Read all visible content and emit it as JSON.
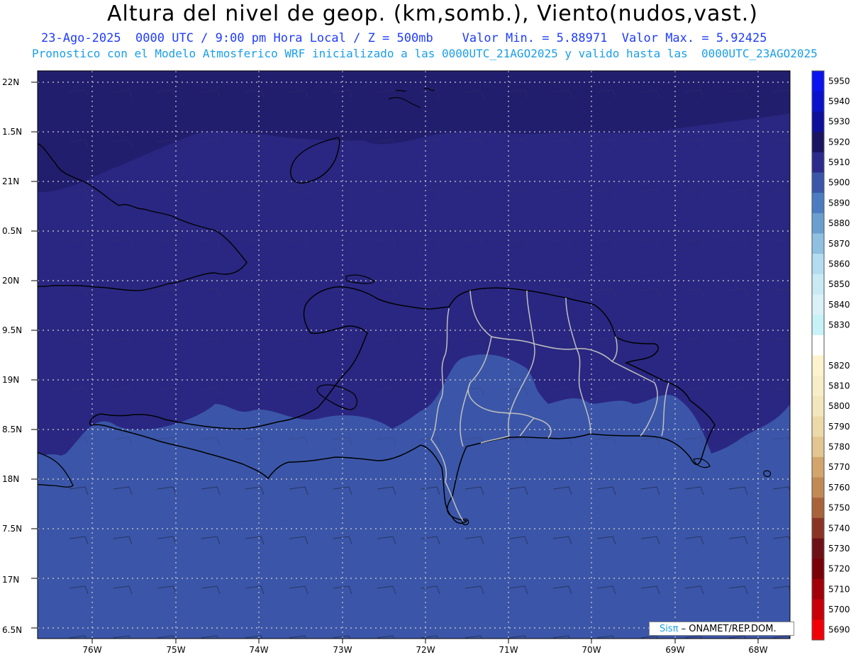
{
  "header": {
    "title": "Altura del nivel de geop. (km,somb.), Viento(nudos,vast.)",
    "line2": "23-Ago-2025  0000 UTC / 9:00 pm Hora Local / Z = 500mb    Valor Min. = 5.88971  Valor Max. = 5.92425",
    "line3": "Pronostico con el Modelo Atmosferico WRF inicializado a las 0000UTC_21AGO2025 y valido hasta las  0000UTC_23AGO2025"
  },
  "axes": {
    "lat_labels": [
      "22N",
      "1.5N",
      "21N",
      "0.5N",
      "20N",
      "9.5N",
      "19N",
      "8.5N",
      "18N",
      "7.5N",
      "17N",
      "6.5N"
    ],
    "lon_labels": [
      "76W",
      "75W",
      "74W",
      "73W",
      "72W",
      "71W",
      "70W",
      "69W",
      "68W"
    ]
  },
  "colorbar": {
    "levels": [
      {
        "label": "5950",
        "color": "#0a13f0"
      },
      {
        "label": "5940",
        "color": "#0b12cc"
      },
      {
        "label": "5930",
        "color": "#0d109a"
      },
      {
        "label": "5920",
        "color": "#1a1462"
      },
      {
        "label": "5910",
        "color": "#2c2a8a"
      },
      {
        "label": "5900",
        "color": "#3b56a8"
      },
      {
        "label": "5890",
        "color": "#4b7cc1"
      },
      {
        "label": "5880",
        "color": "#6a9fd0"
      },
      {
        "label": "5870",
        "color": "#8fc0e0"
      },
      {
        "label": "5860",
        "color": "#b3dcee"
      },
      {
        "label": "5850",
        "color": "#c9eaf5"
      },
      {
        "label": "5840",
        "color": "#daf1f8"
      },
      {
        "label": "5830",
        "color": "#c7f2f7"
      },
      {
        "label": "",
        "color": "#ffffff"
      },
      {
        "label": "5820",
        "color": "#fdf3cf"
      },
      {
        "label": "5810",
        "color": "#f7eec8"
      },
      {
        "label": "5800",
        "color": "#f3e6bc"
      },
      {
        "label": "5790",
        "color": "#ecd9a8"
      },
      {
        "label": "5780",
        "color": "#e2c590"
      },
      {
        "label": "5770",
        "color": "#d1a56d"
      },
      {
        "label": "5760",
        "color": "#c18954"
      },
      {
        "label": "5750",
        "color": "#a9633b"
      },
      {
        "label": "5740",
        "color": "#8a3524"
      },
      {
        "label": "5730",
        "color": "#6e1117"
      },
      {
        "label": "5720",
        "color": "#7a0008"
      },
      {
        "label": "5710",
        "color": "#a10008"
      },
      {
        "label": "5700",
        "color": "#c80008"
      },
      {
        "label": "5690",
        "color": "#f20008"
      }
    ]
  },
  "credit": {
    "brand": "Sisπ",
    "text": "– ONAMET/REP.DOM."
  },
  "colors": {
    "field_high": "#2a2782",
    "field_low": "#3b56a8",
    "coast": "#000000",
    "provinces": "#bfbfbf",
    "grid": "#d0d0d0"
  }
}
